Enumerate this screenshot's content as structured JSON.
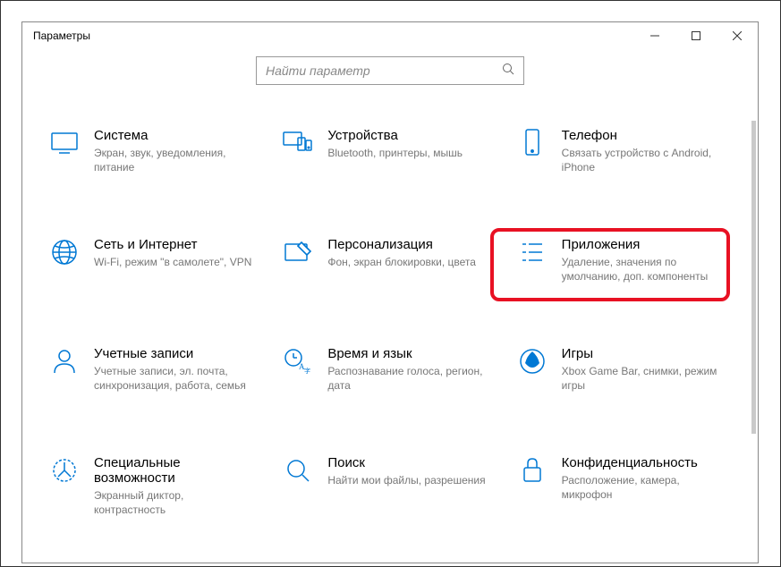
{
  "window": {
    "title": "Параметры"
  },
  "search": {
    "placeholder": "Найти параметр"
  },
  "tiles": {
    "system": {
      "title": "Система",
      "desc": "Экран, звук, уведомления, питание"
    },
    "devices": {
      "title": "Устройства",
      "desc": "Bluetooth, принтеры, мышь"
    },
    "phone": {
      "title": "Телефон",
      "desc": "Связать устройство с Android, iPhone"
    },
    "network": {
      "title": "Сеть и Интернет",
      "desc": "Wi-Fi, режим \"в самолете\", VPN"
    },
    "personalization": {
      "title": "Персонализация",
      "desc": "Фон, экран блокировки, цвета"
    },
    "apps": {
      "title": "Приложения",
      "desc": "Удаление, значения по умолчанию, доп. компоненты"
    },
    "accounts": {
      "title": "Учетные записи",
      "desc": "Учетные записи, эл. почта, синхронизация, работа, семья"
    },
    "time": {
      "title": "Время и язык",
      "desc": "Распознавание голоса, регион, дата"
    },
    "gaming": {
      "title": "Игры",
      "desc": "Xbox Game Bar, снимки, режим игры"
    },
    "ease": {
      "title": "Специальные возможности",
      "desc": "Экранный диктор, контрастность"
    },
    "search_cat": {
      "title": "Поиск",
      "desc": "Найти мои файлы, разрешения"
    },
    "privacy": {
      "title": "Конфиденциальность",
      "desc": "Расположение, камера, микрофон"
    }
  }
}
